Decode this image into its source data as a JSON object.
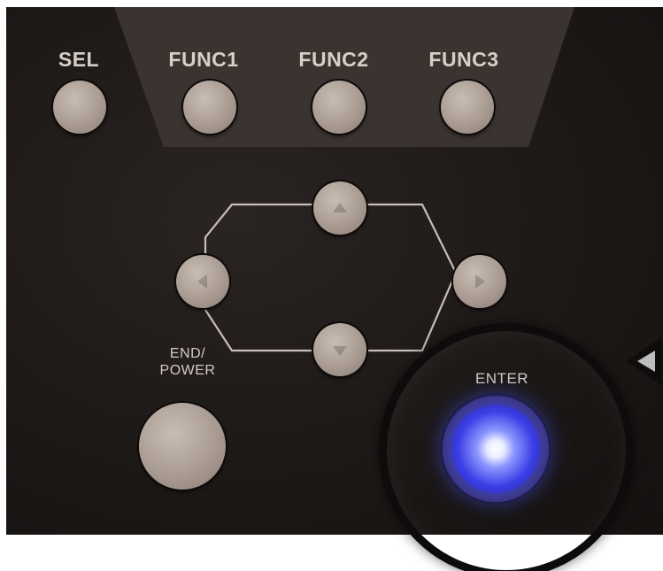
{
  "panel": {
    "labels": {
      "sel": "SEL",
      "func1": "FUNC1",
      "func2": "FUNC2",
      "func3": "FUNC3",
      "end_power_line1": "END/",
      "end_power_line2": "POWER",
      "enter": "ENTER"
    },
    "colors": {
      "panel": "#1d1917",
      "top_plate": "#3a3330",
      "button": "#b1a49b",
      "label": "#d9cfc9",
      "enter_glow": "#3c3fe6",
      "enter_ring": "#3b2f6a"
    },
    "icons": {
      "up": "chevron-up-icon",
      "down": "chevron-down-icon",
      "left": "chevron-left-icon",
      "right": "chevron-right-icon"
    }
  },
  "highlight": {
    "target": "enter",
    "shape": "circle-magnifier"
  }
}
